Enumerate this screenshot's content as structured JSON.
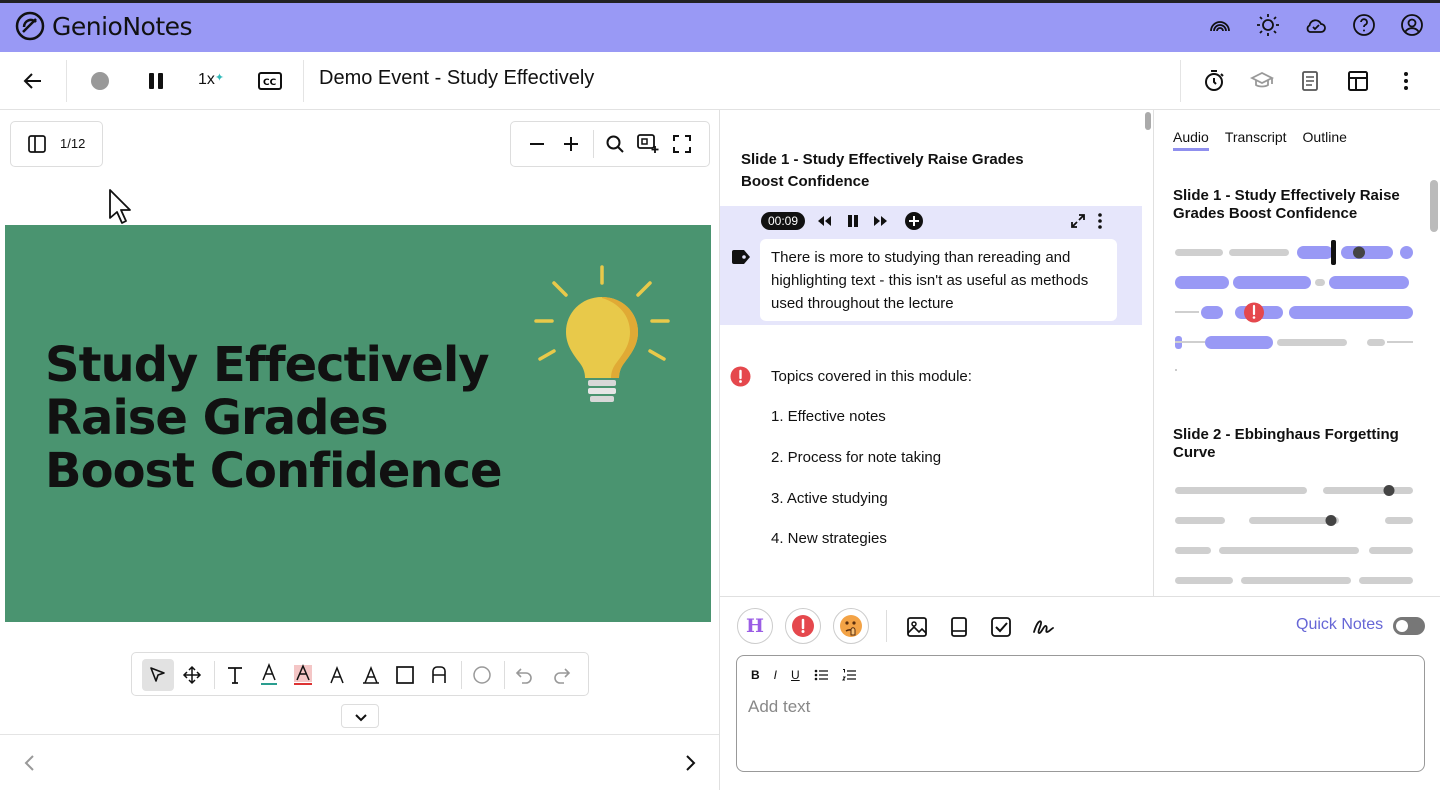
{
  "app": {
    "brand": "GenioNotes"
  },
  "toolbar": {
    "speed": "1x",
    "document_title": "Demo Event - Study Effectively"
  },
  "viewer": {
    "page_indicator": "1/12",
    "slide_title_lines": [
      "Study Effectively",
      "Raise Grades",
      "Boost Confidence"
    ]
  },
  "notes": {
    "slide_heading": "Slide 1 - Study Effectively Raise Grades Boost Confidence",
    "audio_time": "00:09",
    "audio_note": "There is more to studying than rereading and highlighting text - this isn't as useful as methods used throughout the lecture",
    "topics_heading": "Topics covered in this module:",
    "topics": [
      "1. Effective notes",
      "2. Process for note taking",
      "3. Active studying",
      "4. New strategies"
    ]
  },
  "side_panel": {
    "tabs": [
      "Audio",
      "Transcript",
      "Outline"
    ],
    "slides": [
      {
        "title": "Slide 1 - Study Effectively Raise Grades Boost Confidence"
      },
      {
        "title": "Slide 2 - Ebbinghaus Forgetting Curve"
      }
    ]
  },
  "editor": {
    "highlight_label": "H",
    "quick_notes_label": "Quick Notes",
    "placeholder": "Add text",
    "format_labels": [
      "B",
      "I",
      "U"
    ]
  },
  "colors": {
    "header_bg": "#9999f5",
    "accent": "#8f8fee",
    "slide_bg": "#4a9470",
    "alert_red": "#e5484d",
    "bulb_yellow": "#e8c94a"
  }
}
